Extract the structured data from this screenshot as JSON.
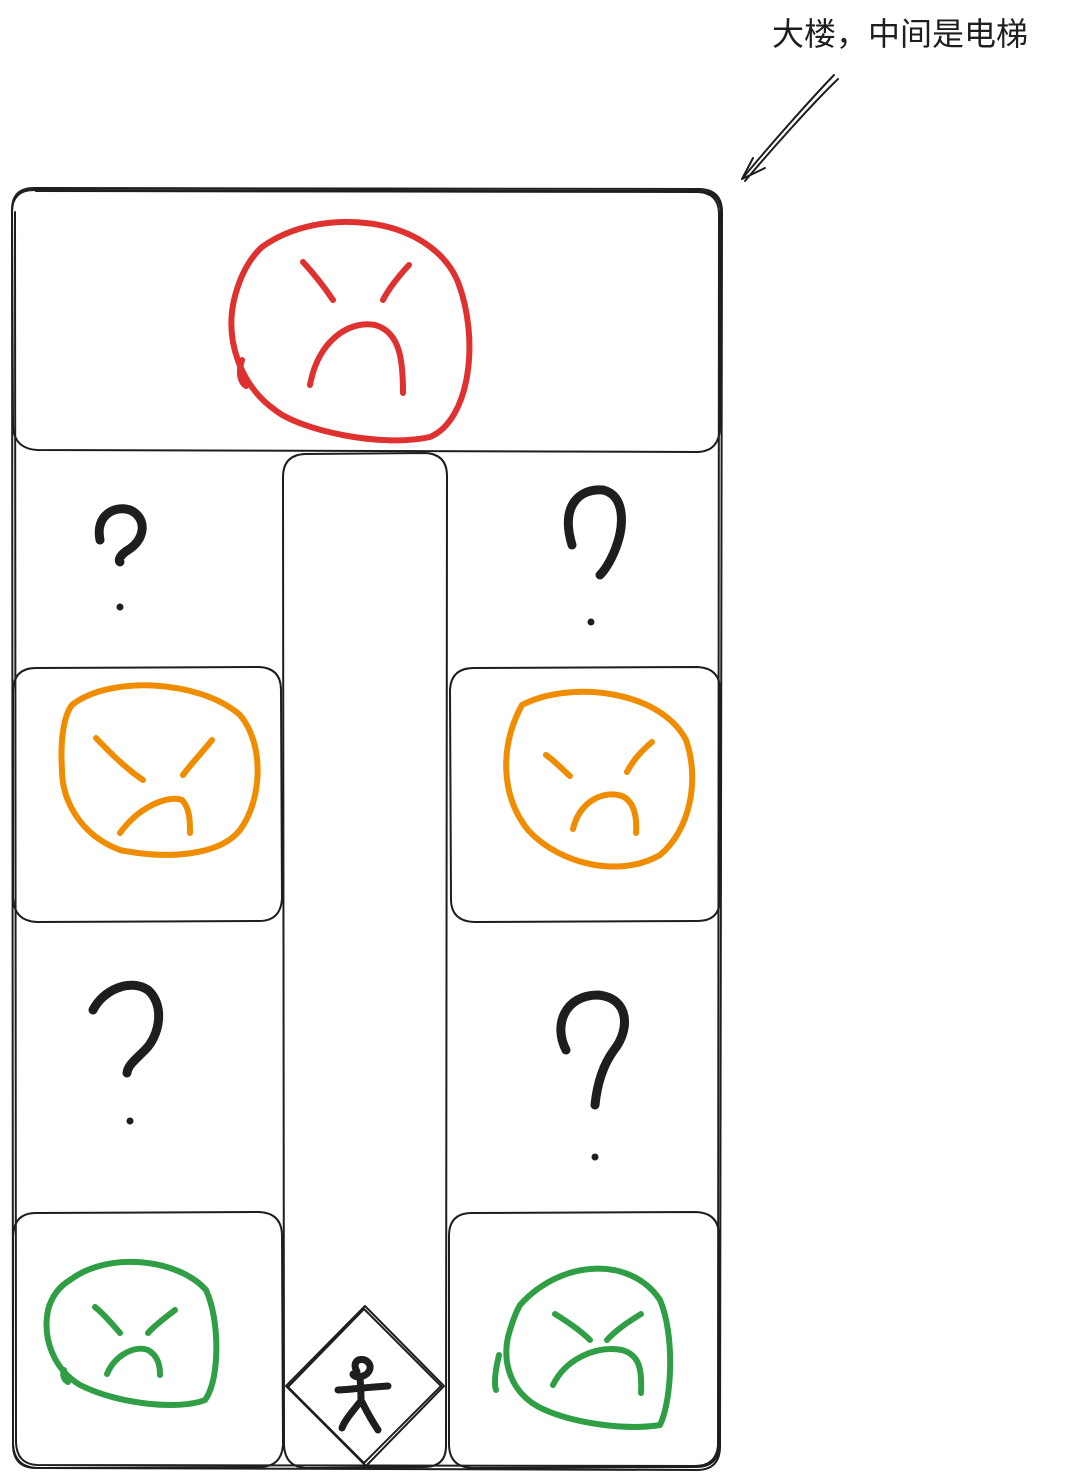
{
  "annotation": {
    "text": "大楼，中间是电梯"
  },
  "colors": {
    "stroke": "#1e1e1e",
    "angry_top": "#e03131",
    "angry_middle": "#f08c00",
    "angry_bottom": "#2f9e44"
  },
  "icons": {
    "top_face": "angry-face-icon",
    "middle_faces": "angry-face-icon",
    "bottom_faces": "angry-face-icon",
    "unknown_floors": "question-mark-icon",
    "person": "person-icon"
  }
}
